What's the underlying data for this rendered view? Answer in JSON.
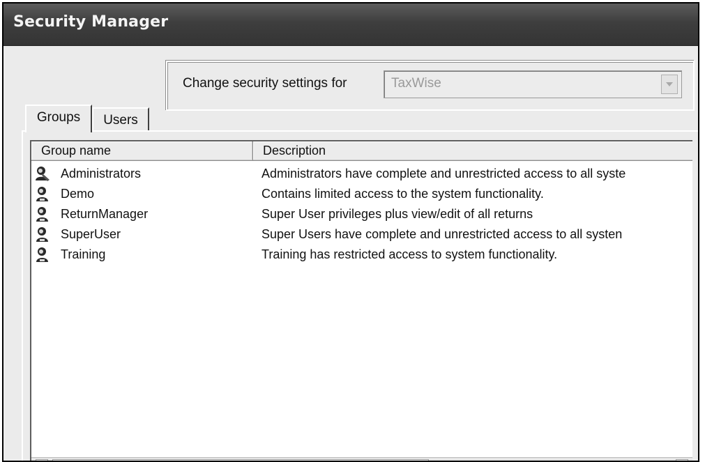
{
  "window": {
    "title": "Security Manager"
  },
  "settings": {
    "label": "Change security settings for",
    "selected": "TaxWise"
  },
  "tabs": [
    {
      "label": "Groups",
      "active": true
    },
    {
      "label": "Users",
      "active": false
    }
  ],
  "list": {
    "columns": [
      "Group name",
      "Description"
    ],
    "rows": [
      {
        "icon": "admin-group-icon",
        "name": "Administrators",
        "description": "Administrators have complete and unrestricted access to all syste"
      },
      {
        "icon": "user-group-icon",
        "name": "Demo",
        "description": "Contains limited access to the system functionality."
      },
      {
        "icon": "user-group-icon",
        "name": "ReturnManager",
        "description": "Super User privileges plus view/edit of all returns"
      },
      {
        "icon": "user-group-icon",
        "name": "SuperUser",
        "description": "Super Users have complete and unrestricted access  to all systen"
      },
      {
        "icon": "user-group-icon",
        "name": "Training",
        "description": "Training has restricted access to system functionality."
      }
    ]
  },
  "colors": {
    "titlebar": "#3e3e3e",
    "window_bg": "#ebebeb",
    "list_bg": "#ffffff"
  }
}
